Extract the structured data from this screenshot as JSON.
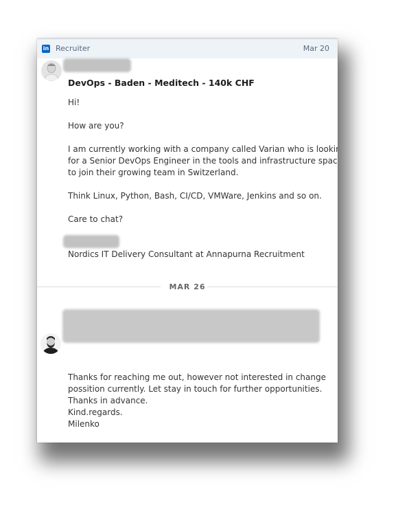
{
  "header": {
    "logo_text": "in",
    "label": "Recruiter",
    "date": "Mar 20"
  },
  "message1": {
    "subject": "DevOps - Baden - Meditech - 140k CHF",
    "lines": [
      "Hi!",
      "How are you?",
      "I am currently working with a company called Varian who is looking",
      "for a Senior DevOps Engineer in the tools and infrastructure space",
      "to join their growing team in Switzerland.",
      "Think Linux, Python, Bash, CI/CD, VMWare, Jenkins and so on.",
      "Care to chat?"
    ],
    "signature": "Nordics IT Delivery Consultant at Annapurna Recruitment"
  },
  "divider": {
    "date": "MAR 26"
  },
  "message2": {
    "lines": [
      "Thanks for reaching me out, however not interested in change",
      "possition currently. Let stay in touch for further opportunities.",
      "Thanks in advance.",
      "Kind.regards.",
      "Milenko"
    ]
  },
  "icons": {
    "linkedin": "linkedin-icon",
    "sender_avatar": "recruiter-avatar",
    "reply_avatar": "user-avatar"
  }
}
